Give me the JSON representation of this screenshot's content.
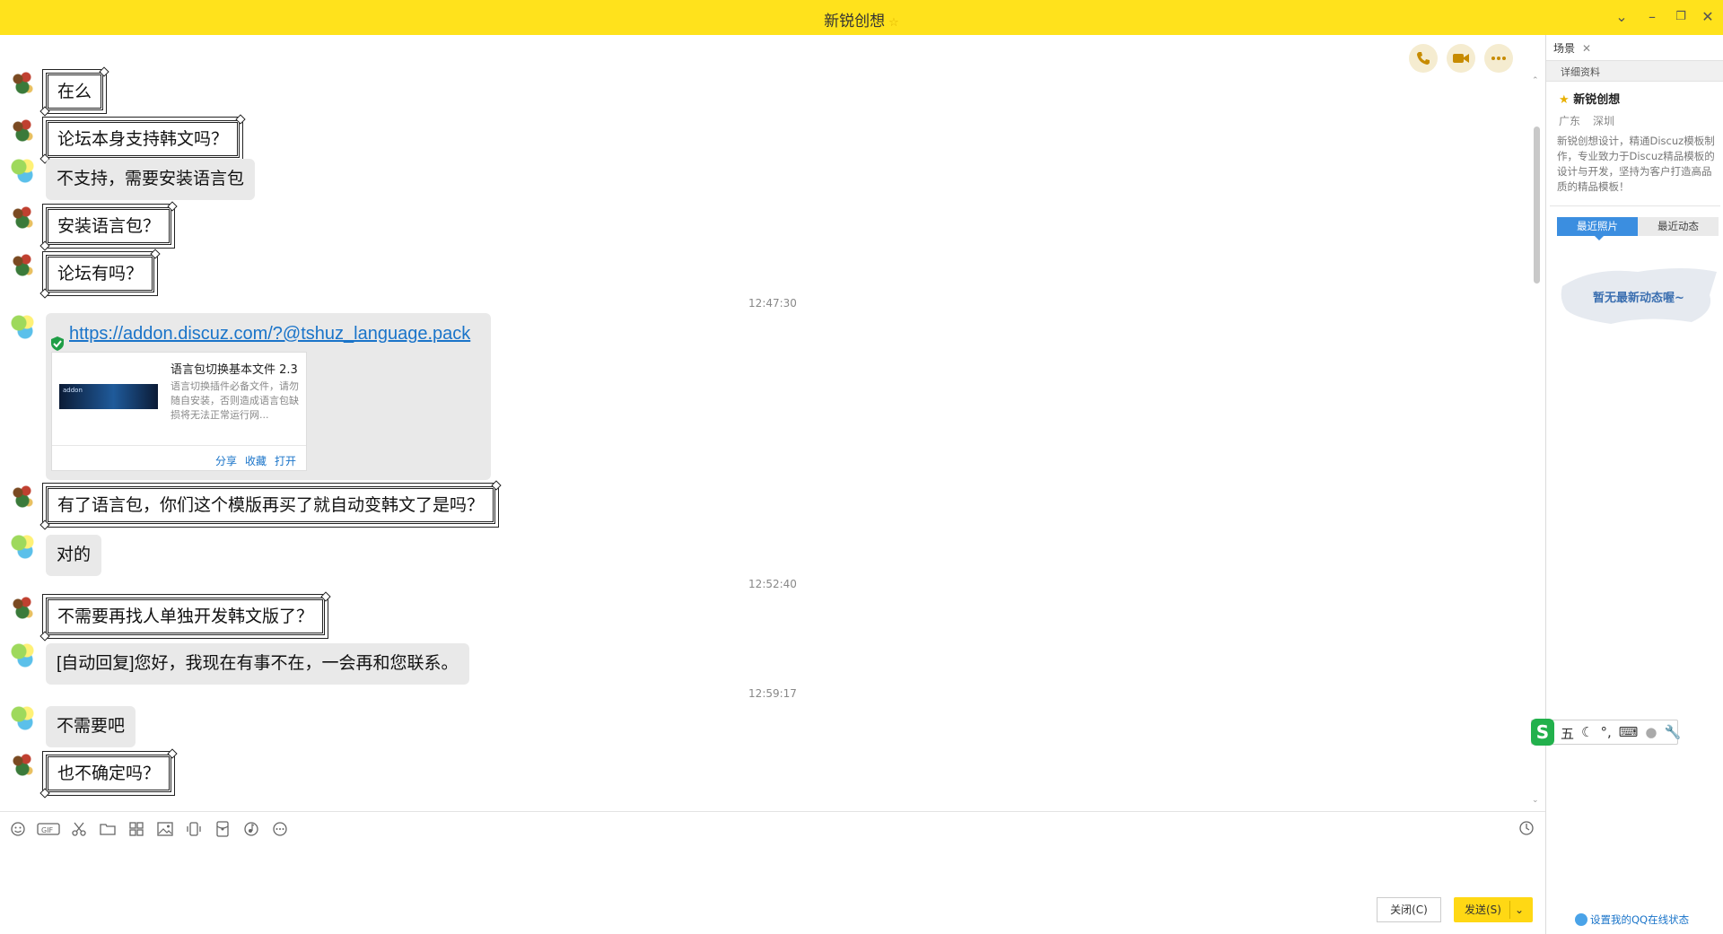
{
  "window": {
    "title": "新锐创想"
  },
  "chat": {
    "messages": [
      {
        "from": "me",
        "text": "在么"
      },
      {
        "from": "me",
        "text": "论坛本身支持韩文吗？"
      },
      {
        "from": "them",
        "text": "不支持，需要安装语言包"
      },
      {
        "from": "me",
        "text": "安装语言包？"
      },
      {
        "from": "me",
        "text": "论坛有吗？"
      },
      {
        "from": "me",
        "text": "有了语言包，你们这个模版再买了就自动变韩文了是吗？"
      },
      {
        "from": "them",
        "text": "对的"
      },
      {
        "from": "me",
        "text": "不需要再找人单独开发韩文版了？"
      },
      {
        "from": "them",
        "text": "[自动回复]您好，我现在有事不在，一会再和您联系。"
      },
      {
        "from": "them",
        "text": "不需要吧"
      },
      {
        "from": "me",
        "text": "也不确定吗？"
      }
    ],
    "timestamps": [
      "12:47:30",
      "12:52:40",
      "12:59:17"
    ],
    "link_card": {
      "url": "https://addon.discuz.com/?@tshuz_language.pack",
      "title": "语言包切换基本文件 2.3",
      "description": "语言切换插件必备文件，请勿随自安装，否则造成语言包缺损将无法正常运行网...",
      "actions": [
        "分享",
        "收藏",
        "打开"
      ]
    }
  },
  "input": {
    "close_label": "关闭(C)",
    "send_label": "发送(S)"
  },
  "panel": {
    "tab_label": "场景",
    "section_title": "详细资料",
    "name": "新锐创想",
    "province": "广东",
    "city": "深圳",
    "description": "新锐创想设计，精通Discuz模板制作，专业致力于Discuz精品模板的设计与开发，坚持为客户打造高品质的精品模板！",
    "tabs": [
      "最近照片",
      "最近动态"
    ],
    "empty_text": "暂无最新动态喔~",
    "footer_link": "设置我的QQ在线状态"
  },
  "ime": {
    "mode": "五"
  },
  "colors": {
    "titlebar": "#ffe21c",
    "send_button": "#ffd814",
    "link": "#1a74c9",
    "tab_active": "#3b8ee0"
  }
}
